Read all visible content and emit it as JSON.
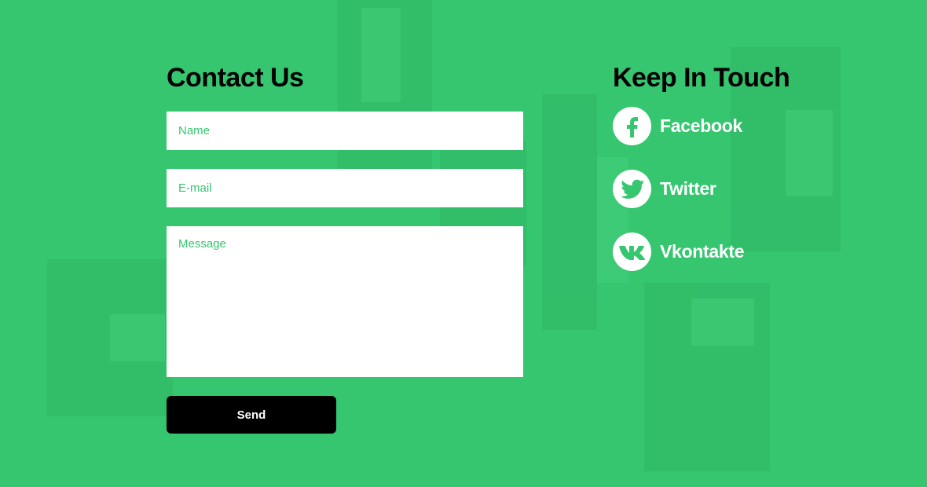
{
  "colors": {
    "background": "#35c66f",
    "accent_text": "#35c66f",
    "heading": "#000000",
    "button_bg": "#000000",
    "button_text": "#ffffff",
    "social_text": "#ffffff"
  },
  "contact": {
    "title": "Contact Us",
    "name_placeholder": "Name",
    "email_placeholder": "E-mail",
    "message_placeholder": "Message",
    "send_label": "Send"
  },
  "touch": {
    "title": "Keep In Touch",
    "links": [
      {
        "label": "Facebook",
        "icon": "facebook-icon"
      },
      {
        "label": "Twitter",
        "icon": "twitter-icon"
      },
      {
        "label": "Vkontakte",
        "icon": "vk-icon"
      }
    ]
  }
}
